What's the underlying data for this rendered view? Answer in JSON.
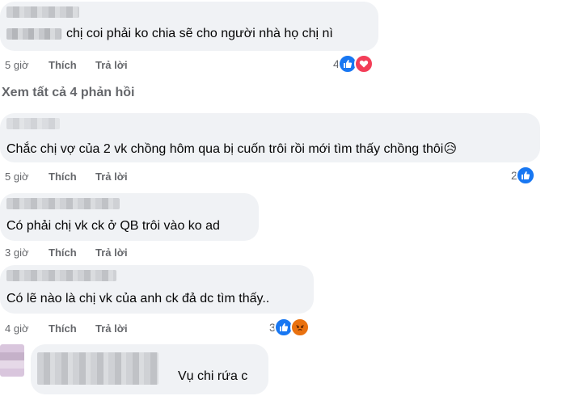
{
  "comments": [
    {
      "text": "chị coi phải ko chia sẽ cho người nhà họ chị nì",
      "time": "5 giờ",
      "like": "Thích",
      "reply": "Trả lời",
      "reaction_count": "4",
      "reactions": [
        "like-icon",
        "love-icon"
      ]
    },
    {
      "text": "Chắc chị vợ của 2 vk chồng hôm qua bị cuốn trôi rồi mới tìm thấy chồng thôi😥",
      "time": "5 giờ",
      "like": "Thích",
      "reply": "Trả lời",
      "reaction_count": "2",
      "reactions": [
        "like-icon"
      ]
    },
    {
      "text": "Có phải chị vk ck ở QB trôi vào ko ad",
      "time": "3 giờ",
      "like": "Thích",
      "reply": "Trả lời"
    },
    {
      "text": "Có lẽ nào là chị vk của anh ck đả dc tìm thấy..",
      "time": "4 giờ",
      "like": "Thích",
      "reply": "Trả lời",
      "reaction_count": "3",
      "reactions": [
        "like-icon",
        "angry-icon"
      ]
    },
    {
      "text": "Vụ chi rứa c"
    }
  ],
  "see_all_replies": "Xem tất cả 4 phản hồi",
  "colors": {
    "bubble": "#f0f2f5",
    "meta_text": "#65676b",
    "like_blue": "#1877f2",
    "love_red": "#f33e58",
    "angry_orange": "#e9710f"
  }
}
